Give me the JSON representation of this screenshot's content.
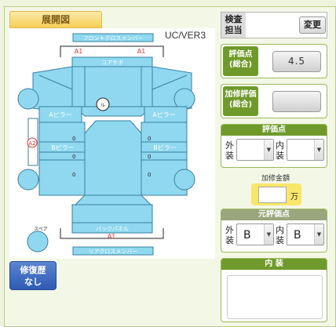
{
  "diagram": {
    "tab_title": "展開図",
    "version": "UC/VER3",
    "labels": {
      "front_cross": "フロントクロスメンバー",
      "a1_left": "A1",
      "a1_right": "A1",
      "core_support": "コアサポ",
      "a_pillar_left": "Aピラー",
      "a_pillar_right": "Aピラー",
      "b_pillar_left": "Bピラー",
      "b_pillar_right": "Bピラー",
      "a2": "A2",
      "zero_1": "0",
      "zero_2": "0",
      "zero_3": "0",
      "zero_4": "0",
      "zero_5": "0",
      "zero_6": "0",
      "spare": "スペア",
      "back_panel": "バックパネル",
      "a1_rear": "A1",
      "rear_cross": "リアクロスメンバー",
      "roof_mark": "ル"
    }
  },
  "repair_history": {
    "line1": "修復歴",
    "line2": "なし"
  },
  "inspector": {
    "label_line1": "検査",
    "label_line2": "担当",
    "change_label": "変更"
  },
  "overall_score": {
    "label_line1": "評価点",
    "label_line2": "(総合)",
    "value": "4.5"
  },
  "processed_score": {
    "label_line1": "加修評価",
    "label_line2": "(総合)",
    "value": ""
  },
  "score_group": {
    "title": "評価点",
    "exterior_label_1": "外",
    "exterior_label_2": "装",
    "interior_label_1": "内",
    "interior_label_2": "装",
    "exterior_value": "",
    "interior_value": ""
  },
  "repair_amount": {
    "title": "加修金額",
    "value": "",
    "unit": "万"
  },
  "original_score_group": {
    "title": "元評価点",
    "exterior_label_1": "外",
    "exterior_label_2": "装",
    "interior_label_1": "内",
    "interior_label_2": "装",
    "exterior_value": "B",
    "interior_value": "B"
  },
  "interior_notes": {
    "title": "内 装",
    "text": ""
  },
  "colors": {
    "panel_fill": "#8fd8f0",
    "panel_stroke": "#3a7f9e",
    "label_red": "#e0342a",
    "header_green": "#6f9a2b",
    "repair_blue": "#2e5bb4"
  }
}
